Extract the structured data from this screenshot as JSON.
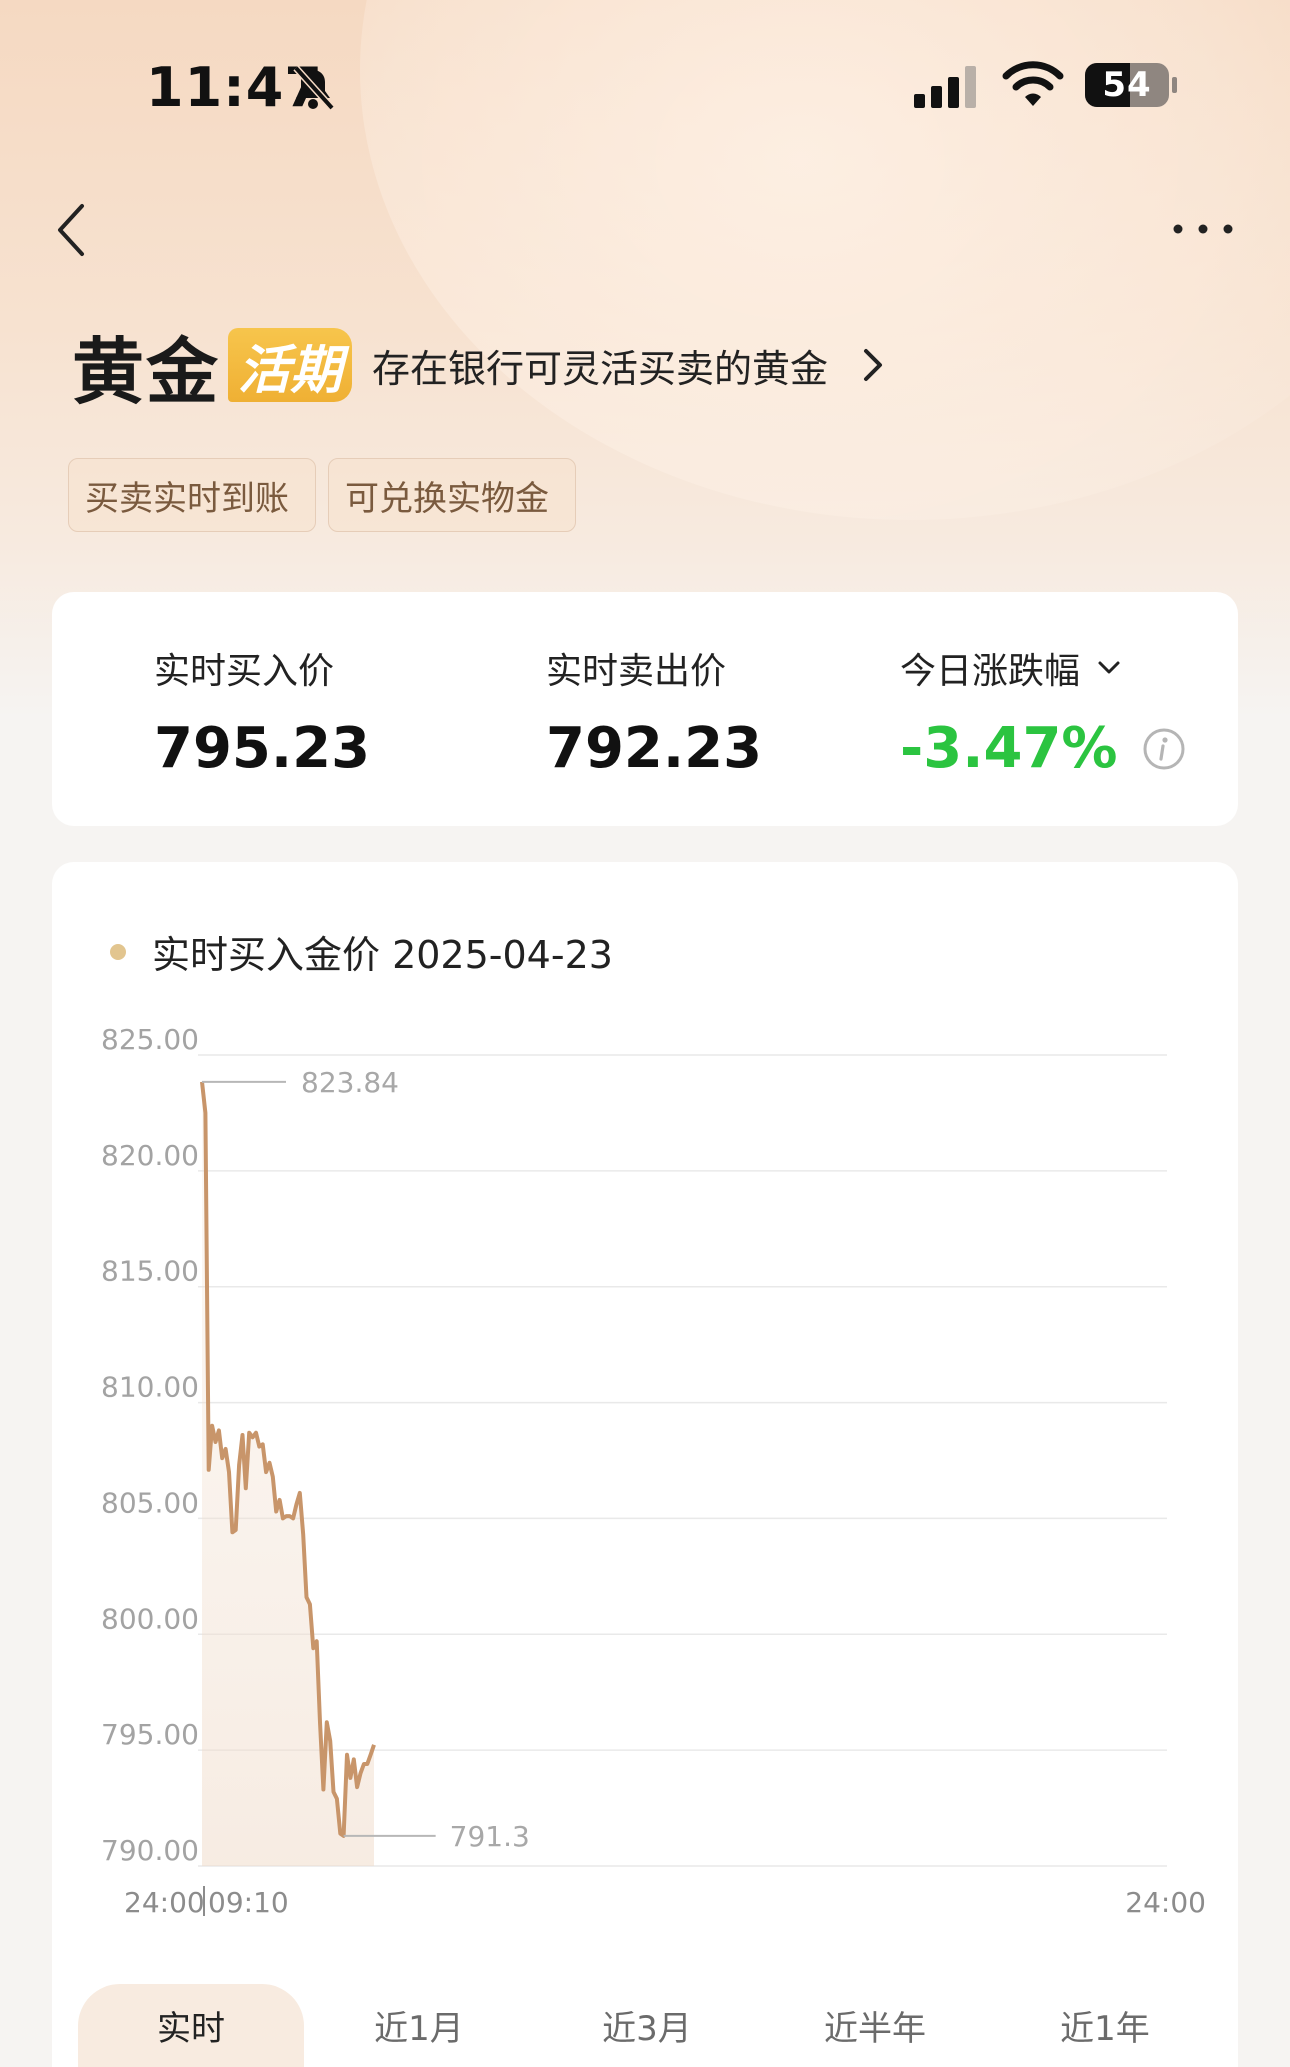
{
  "status_bar": {
    "time": "11:47",
    "battery": "54"
  },
  "header": {
    "title": "黄金",
    "badge": "活期",
    "description": "存在银行可灵活买卖的黄金",
    "tags": [
      "买卖实时到账",
      "可兑换实物金"
    ]
  },
  "prices": {
    "buy_label": "实时买入价",
    "buy_value": "795.23",
    "sell_label": "实时卖出价",
    "sell_value": "792.23",
    "change_label": "今日涨跌幅",
    "change_value": "-3.47%"
  },
  "colors": {
    "accent_gold": "#f2b63c",
    "line_color": "#c8956a",
    "negative_green": "#2bc440",
    "legend_dot": "#e2c58f"
  },
  "range_tabs": [
    {
      "label": "实时",
      "active": true
    },
    {
      "label": "近1月",
      "active": false
    },
    {
      "label": "近3月",
      "active": false
    },
    {
      "label": "近半年",
      "active": false
    },
    {
      "label": "近1年",
      "active": false
    }
  ],
  "chart_data": {
    "type": "line",
    "title": "实时买入金价 2025-04-23",
    "legend": "实时买入金价 2025-04-23",
    "xlabel": "",
    "ylabel": "",
    "x_tick_labels": [
      "24:00",
      "09:10",
      "24:00"
    ],
    "y_ticks": [
      "825.00",
      "820.00",
      "815.00",
      "810.00",
      "805.00",
      "800.00",
      "795.00",
      "790.00"
    ],
    "ylim": [
      790,
      825
    ],
    "grid": true,
    "max_label": "823.84",
    "min_label": "791.3",
    "series": [
      {
        "name": "实时买入金价",
        "values": [
          823.84,
          822.5,
          807.1,
          809.0,
          808.3,
          808.8,
          807.6,
          808.0,
          807.0,
          804.4,
          804.5,
          807.3,
          808.6,
          806.3,
          808.7,
          808.5,
          808.7,
          808.1,
          808.2,
          807.0,
          807.4,
          806.8,
          805.3,
          805.8,
          805.0,
          805.1,
          805.1,
          805.0,
          805.6,
          806.1,
          804.3,
          801.6,
          801.3,
          799.4,
          799.7,
          796.2,
          793.3,
          796.2,
          795.4,
          793.2,
          792.9,
          791.4,
          791.3,
          794.8,
          793.8,
          794.6,
          793.4,
          794.0,
          794.4,
          794.4,
          794.8,
          795.23
        ]
      }
    ]
  }
}
